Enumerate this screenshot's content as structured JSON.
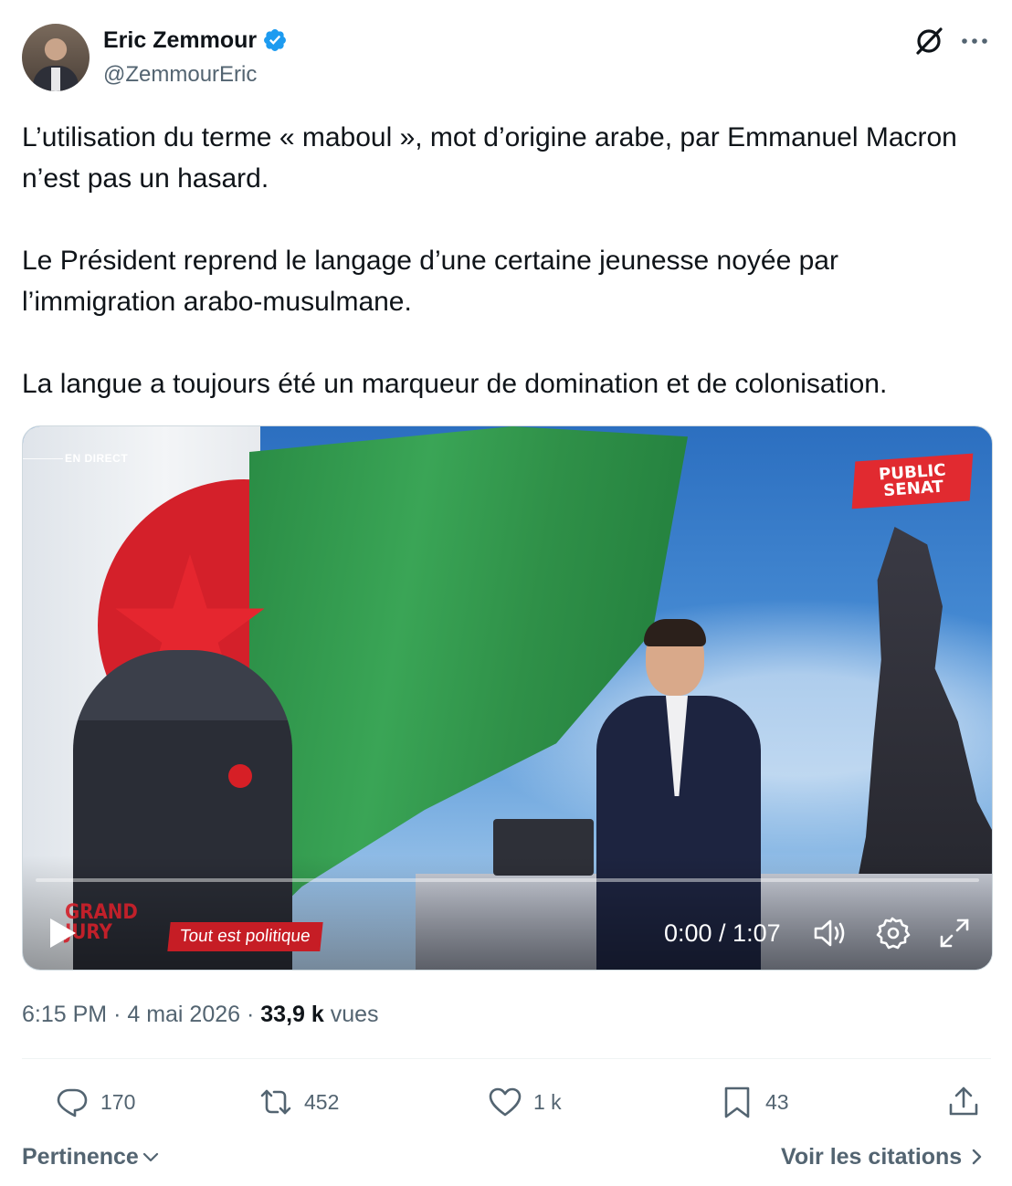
{
  "author": {
    "name": "Eric Zemmour",
    "handle": "@ZemmourEric",
    "verified": true
  },
  "tweet": {
    "paragraphs": [
      "L’utilisation du terme « maboul », mot d’origine arabe, par Emmanuel Macron n’est pas un hasard.",
      "Le Président reprend le langage d’une certaine jeunesse noyée par l’immigration arabo-musulmane.",
      "La langue a toujours été un marqueur de domination et de colonisation."
    ]
  },
  "video": {
    "live_label": "EN DIRECT",
    "channel_logo": [
      "PUBLIC",
      "SENAT"
    ],
    "show_logo": [
      "GRAND",
      "JURY"
    ],
    "show_tag": "Tout est politique",
    "time_display": "0:00 / 1:07",
    "progress": 0
  },
  "meta": {
    "time": "6:15 PM",
    "date": "4 mai 2026",
    "views_count": "33,9 k",
    "views_label": "vues",
    "separator": "·"
  },
  "actions": {
    "replies": "170",
    "reposts": "452",
    "likes": "1 k",
    "bookmarks": "43"
  },
  "footer": {
    "sort_label": "Pertinence",
    "quotes_label": "Voir les citations"
  },
  "colors": {
    "accent": "#1d9bf0",
    "secondary_text": "#536471",
    "primary_text": "#0f1419"
  },
  "icons": [
    "verified-badge-icon",
    "grok-icon",
    "more-icon",
    "play-icon",
    "volume-icon",
    "settings-icon",
    "fullscreen-icon",
    "reply-icon",
    "repost-icon",
    "like-icon",
    "bookmark-icon",
    "share-icon",
    "chevron-down-icon",
    "chevron-right-icon"
  ]
}
